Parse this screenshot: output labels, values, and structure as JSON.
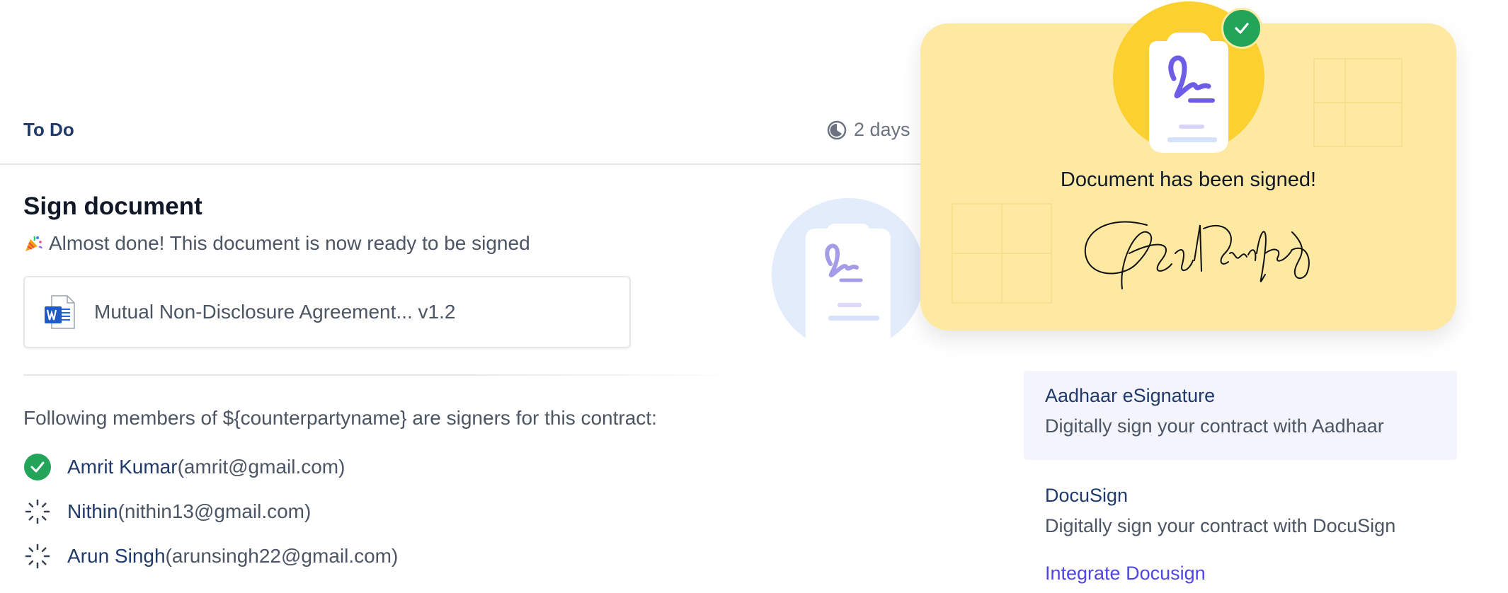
{
  "header": {
    "section_label": "To Do",
    "timer_text": "2 days"
  },
  "main": {
    "title": "Sign document",
    "subtitle": "Almost done! This document is now ready to be signed",
    "document": {
      "name": "Mutual Non-Disclosure Agreement... v1.2",
      "icon": "word-doc-icon"
    },
    "signers_intro": "Following members of ${counterpartyname} are signers for this contract:",
    "signers": [
      {
        "name": "Amrit Kumar",
        "email": " (amrit@gmail.com)",
        "status": "signed"
      },
      {
        "name": "Nithin",
        "email": " (nithin13@gmail.com)",
        "status": "pending"
      },
      {
        "name": "Arun Singh",
        "email": "(arunsingh22@gmail.com)",
        "status": "pending"
      }
    ]
  },
  "popup": {
    "message": "Document has been signed!",
    "background_color": "#fde9a2",
    "badge_color": "#fcd02e",
    "check_color": "#22a559"
  },
  "options": [
    {
      "title": "Aadhaar eSignature",
      "description": "Digitally sign your contract with Aadhaar",
      "active": true
    },
    {
      "title": "DocuSign",
      "description": "Digitally sign your contract with DocuSign",
      "active": false
    }
  ],
  "integrate_link": "Integrate Docusign",
  "colors": {
    "accent": "#4f46e5",
    "signed_green": "#22a559",
    "navy_text": "#1f3a6b"
  }
}
